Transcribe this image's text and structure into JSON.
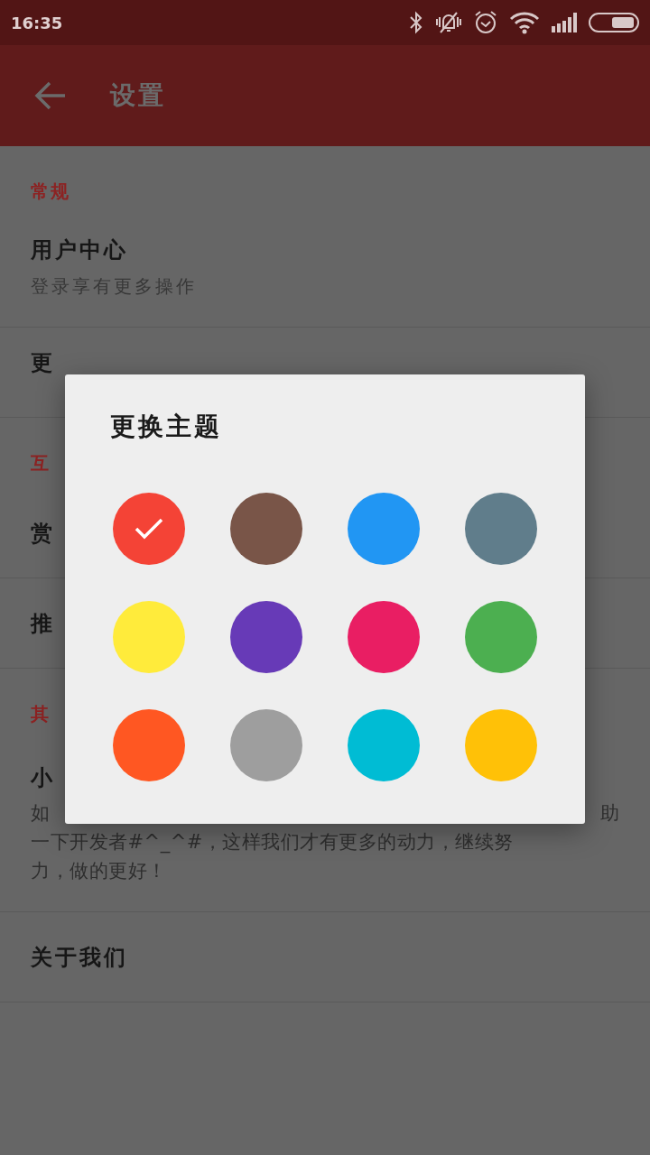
{
  "status_bar": {
    "time": "16:35"
  },
  "app_bar": {
    "title": "设置"
  },
  "sections": [
    {
      "header": "常规",
      "items": [
        {
          "title": "用户中心",
          "subtitle": "登录享有更多操作"
        },
        {
          "title": "更"
        }
      ]
    },
    {
      "header": "互",
      "items": [
        {
          "title": "赏"
        },
        {
          "title": "推"
        }
      ]
    },
    {
      "header": "其",
      "items": [
        {
          "title": "小",
          "description": {
            "left": "如",
            "right": "助",
            "lines": [
              "一下开发者#^_^#，这样我们才有更多的动力，继续努",
              "力，做的更好！"
            ]
          }
        },
        {
          "title": "关于我们"
        }
      ]
    }
  ],
  "dialog": {
    "title": "更换主题",
    "colors": [
      {
        "color": "#f44336",
        "selected": true
      },
      {
        "color": "#795548",
        "selected": false
      },
      {
        "color": "#2196f3",
        "selected": false
      },
      {
        "color": "#607d8b",
        "selected": false
      },
      {
        "color": "#ffeb3b",
        "selected": false
      },
      {
        "color": "#673ab7",
        "selected": false
      },
      {
        "color": "#e91e63",
        "selected": false
      },
      {
        "color": "#4caf50",
        "selected": false
      },
      {
        "color": "#ff5722",
        "selected": false
      },
      {
        "color": "#9e9e9e",
        "selected": false
      },
      {
        "color": "#00bcd4",
        "selected": false
      },
      {
        "color": "#ffc107",
        "selected": false
      }
    ]
  }
}
